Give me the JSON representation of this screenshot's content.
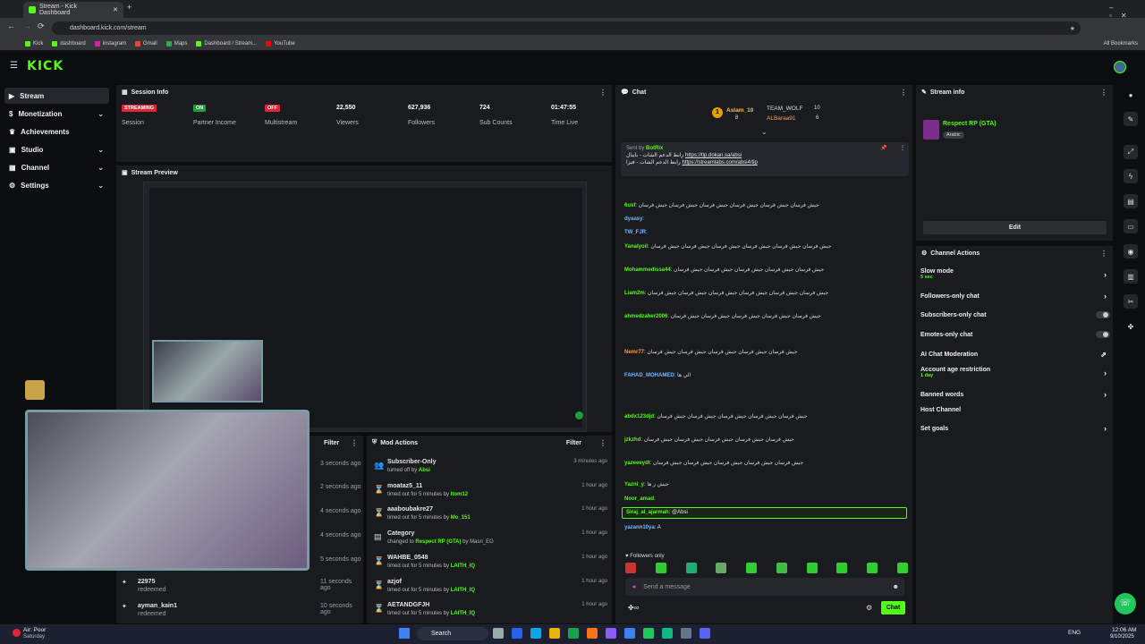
{
  "browser": {
    "tab_title": "Stream - Kick Dashboard",
    "url": "dashboard.kick.com/stream",
    "bookmarks": [
      "Kick",
      "dashboard",
      "instagram",
      "Gmail",
      "Maps",
      "Dashboard / Stream...",
      "YouTube"
    ],
    "all_bookmarks": "All Bookmarks"
  },
  "brand": {
    "logo": "KICK",
    "accent": "#53fc18"
  },
  "sidebar": {
    "items": [
      {
        "label": "Stream"
      },
      {
        "label": "Monetization"
      },
      {
        "label": "Achievements"
      },
      {
        "label": "Studio"
      },
      {
        "label": "Channel"
      },
      {
        "label": "Settings"
      }
    ]
  },
  "session": {
    "title": "Session Info",
    "stats": [
      {
        "value": "STREAMING",
        "label": "Session"
      },
      {
        "value": "ON",
        "label": "Partner Income"
      },
      {
        "value": "OFF",
        "label": "Multistream"
      },
      {
        "value": "22,550",
        "label": "Viewers"
      },
      {
        "value": "627,936",
        "label": "Followers"
      },
      {
        "value": "724",
        "label": "Sub Counts"
      },
      {
        "value": "01:47:55",
        "label": "Time Live"
      }
    ]
  },
  "preview": {
    "title": "Stream Preview"
  },
  "activity": {
    "filter": "Filter",
    "rows": [
      {
        "time": "3 seconds ago"
      },
      {
        "time": "2 seconds ago"
      },
      {
        "time": "4 seconds ago"
      },
      {
        "time": "4 seconds ago"
      },
      {
        "time": "5 seconds ago"
      },
      {
        "name": "22975",
        "action": "redeemed",
        "time": "11 seconds ago"
      },
      {
        "name": "ayman_kain1",
        "action": "redeemed",
        "time": "10 seconds ago"
      }
    ]
  },
  "mod_actions": {
    "title": "Mod Actions",
    "filter": "Filter",
    "rows": [
      {
        "title": "Subscriber-Only",
        "detail": "turned off by",
        "by": "Absi",
        "time": "3 minutes ago"
      },
      {
        "title": "moataz5_11",
        "detail": "timed out for 5 minutes by",
        "by": "Itom12",
        "time": "1 hour ago"
      },
      {
        "title": "aaaboubakre27",
        "detail": "timed out for 5 minutes by",
        "by": "Mo_151",
        "time": "1 hour ago"
      },
      {
        "title": "Category",
        "detail": "changed to",
        "by": "Respect RP (GTA)",
        "by2": "by Masri_EG",
        "time": "1 hour ago"
      },
      {
        "title": "WAHBE_0548",
        "detail": "timed out for 5 minutes by",
        "by": "LAITH_IQ",
        "time": "1 hour ago"
      },
      {
        "title": "azjof",
        "detail": "timed out for 5 minutes by",
        "by": "LAITH_IQ",
        "time": "1 hour ago"
      },
      {
        "title": "AETANDGFJH",
        "detail": "timed out for 5 minutes by",
        "by": "LAITH_IQ",
        "time": "1 hour ago"
      }
    ]
  },
  "chat": {
    "title": "Chat",
    "leaders": [
      {
        "name": "Aslam_10",
        "count": "8"
      },
      {
        "name": "TEAM_WOLF",
        "count": "10"
      },
      {
        "name": "ALBaraa91",
        "count": "6"
      }
    ],
    "pinned": {
      "sender_prefix": "Sent by",
      "sender": "BotRix",
      "text": "رابط الدعم الشات - بايبال",
      "link1": "https://tip.dokan.sa/absi",
      "text2": "رابط الدعم الشات - فيزا",
      "link2": "https://streamlabs.com/absi4/tip"
    },
    "messages": [
      {
        "user": "6usf",
        "text": "جيش فرسان جيش فرسان جيش فرسان جيش فرسان جيش فرسان جيش فرسان",
        "color": "#53fc18"
      },
      {
        "user": "dyaasy",
        "text": "",
        "color": "#7ab8ff"
      },
      {
        "user": "TW_FJR",
        "text": "",
        "color": "#7ab8ff"
      },
      {
        "user": "Yanalyoil",
        "text": "جيش فرسان جيش فرسان جيش فرسان جيش فرسان جيش فرسان جيش فرسان",
        "color": "#53fc18"
      },
      {
        "user": "Mohammedissa44",
        "text": "جيش فرسان جيش فرسان جيش فرسان جيش فرسان جيش فرسان",
        "color": "#53fc18"
      },
      {
        "user": "Liam2m",
        "text": "جيش فرسان جيش فرسان جيش فرسان جيش فرسان جيش فرسان جيش فرسان",
        "color": "#53fc18"
      },
      {
        "user": "ahmedzaher2006",
        "text": "جيش فرسان جيش فرسان جيش فرسان جيش فرسان جيش فرسان",
        "color": "#53fc18"
      },
      {
        "user": "Nemr77",
        "text": "جيش فرسان جيش فرسان جيش فرسان جيش فرسان جيش فرسان",
        "color": "#ff9a3c"
      },
      {
        "user": "FAHAD_MOHAMED",
        "text": "الي ها",
        "color": "#7ab8ff"
      },
      {
        "user": "abdx123djd",
        "text": "جيش فرسان جيش فرسان جيش فرسان جيش فرسان جيش فرسان",
        "color": "#53fc18"
      },
      {
        "user": "jzkzhd",
        "text": "جيش فرسان جيش فرسان جيش فرسان جيش فرسان جيش فرسان",
        "color": "#53fc18"
      },
      {
        "user": "yazeeeydt",
        "text": "جيش فرسان جيش فرسان جيش فرسان جيش فرسان جيش فرسان",
        "color": "#53fc18"
      },
      {
        "user": "Yazni_y",
        "text": "جيش ز ها",
        "color": "#53fc18"
      },
      {
        "user": "Noor_amad",
        "text": "",
        "color": "#53fc18"
      }
    ],
    "highlight": {
      "user": "Siraj_al_ajarmah",
      "text": "@Absi"
    },
    "after": [
      {
        "user": "yazann10ya",
        "text": "A",
        "color": "#7ab8ff"
      }
    ],
    "followers_only": "Followers only",
    "input_placeholder": "Send a message",
    "send_label": "Chat"
  },
  "stream_info": {
    "title": "Stream info",
    "category": "Respect RP (GTA)",
    "language": "Arabic",
    "edit_label": "Edit"
  },
  "channel_actions": {
    "title": "Channel Actions",
    "items": [
      {
        "label": "Slow mode",
        "sub": "5 sec",
        "ctrl": "arrow"
      },
      {
        "label": "Followers-only chat",
        "sub": "",
        "ctrl": "arrow"
      },
      {
        "label": "Subscribers-only chat",
        "sub": "",
        "ctrl": "toggle"
      },
      {
        "label": "Emotes-only chat",
        "sub": "",
        "ctrl": "toggle"
      },
      {
        "label": "AI Chat Moderation",
        "sub": "",
        "ctrl": "ext"
      },
      {
        "label": "Account age restriction",
        "sub": "1 day",
        "ctrl": "arrow"
      },
      {
        "label": "Banned words",
        "sub": "",
        "ctrl": "arrow"
      },
      {
        "label": "Host Channel",
        "sub": "",
        "ctrl": "none"
      },
      {
        "label": "Set goals",
        "sub": "",
        "ctrl": "arrow"
      }
    ]
  },
  "taskbar": {
    "weather_title": "Air: Poor",
    "weather_sub": "Saturday",
    "search": "Search",
    "lang": "ENG",
    "time": "12:06 AM",
    "date": "9/10/2025"
  }
}
